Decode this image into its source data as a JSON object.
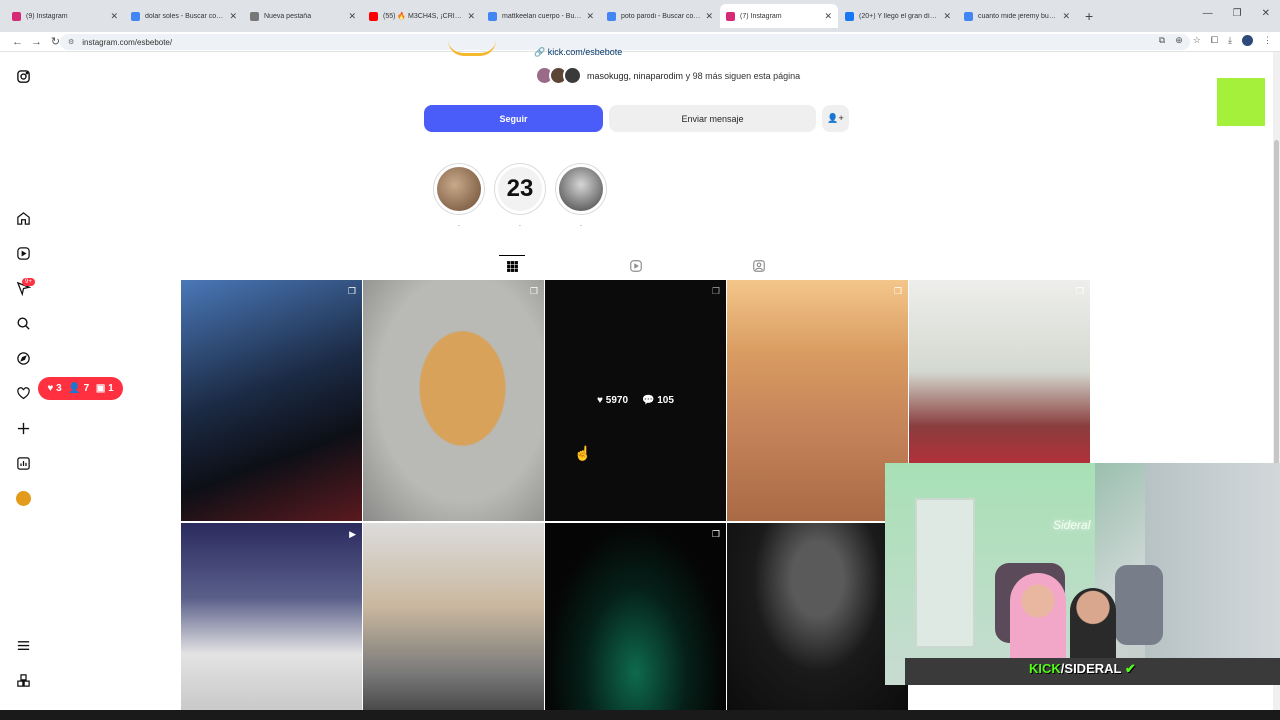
{
  "browser": {
    "tabs": [
      {
        "title": "(9) Instagram",
        "color": "#d62976",
        "active": false
      },
      {
        "title": "dolar soles - Buscar con Google",
        "color": "#4285f4",
        "active": false
      },
      {
        "title": "Nueva pestaña",
        "color": "#777777",
        "active": false
      },
      {
        "title": "(55) 🔥 M3CH4S, ¡CRISTO es DI…",
        "color": "#ff0000",
        "active": false
      },
      {
        "title": "mattkeelan cuerpo - Buscar con …",
        "color": "#4285f4",
        "active": false
      },
      {
        "title": "poto parodi - Buscar con Googl…",
        "color": "#4285f4",
        "active": false
      },
      {
        "title": "(7) Instagram",
        "color": "#d62976",
        "active": true
      },
      {
        "title": "(20+) Y llegó el gran día... Hoy…",
        "color": "#1877f2",
        "active": false
      },
      {
        "title": "cuanto mide jeremy buen dia - …",
        "color": "#4285f4",
        "active": false
      }
    ],
    "url": "instagram.com/esbebote/"
  },
  "sidebar": {
    "notifications_badge": "9+",
    "notif_bubble": {
      "likes": "3",
      "follows": "7",
      "tags": "1"
    }
  },
  "profile": {
    "link": "kick.com/esbebote",
    "followed_by_names": "masokugg, ninaparodim",
    "followed_by_rest": "y 98 más siguen esta página",
    "follow_label": "Seguir",
    "message_label": "Enviar mensaje",
    "highlights": [
      {
        "label": ".",
        "text": "",
        "bg": "#a88c72"
      },
      {
        "label": ".",
        "text": "23",
        "bg": "#f2f2f2"
      },
      {
        "label": ".",
        "text": "",
        "bg": "#7b7b7b"
      }
    ]
  },
  "posts": {
    "hover": {
      "likes": "5970",
      "comments": "105"
    }
  },
  "stream_overlay": {
    "neon_sign": "Sideral",
    "brand": "KICK",
    "channel": "/SIDERAL"
  }
}
